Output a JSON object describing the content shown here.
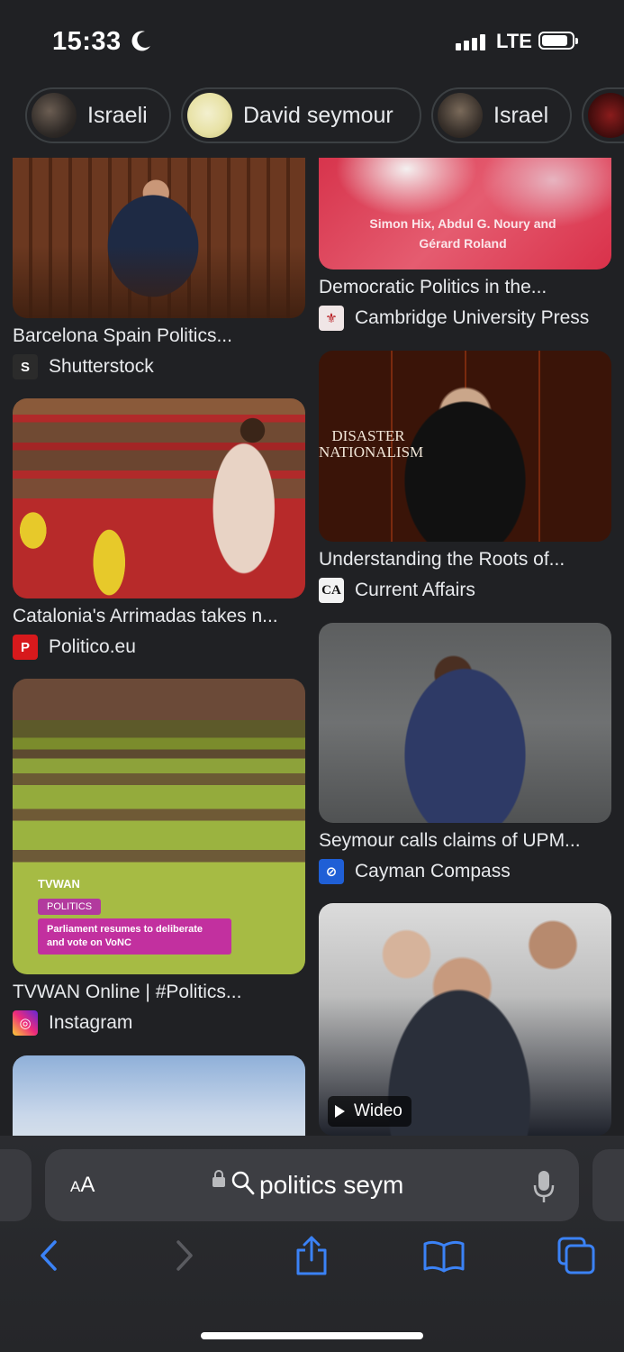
{
  "status": {
    "time": "15:33",
    "network": "LTE"
  },
  "chips": [
    {
      "label": "Israeli"
    },
    {
      "label": "David seymour"
    },
    {
      "label": "Israel"
    }
  ],
  "results": [
    {
      "title": "Barcelona Spain Politics...",
      "source": "Shutterstock",
      "favicon": "shutterstock-icon",
      "favicon_color": "#2b2b2b"
    },
    {
      "title": "Catalonia's Arrimadas takes n...",
      "source": "Politico.eu",
      "favicon": "politico-icon",
      "favicon_color": "#d7191c"
    },
    {
      "title": "TVWAN Online | #Politics...",
      "source": "Instagram",
      "favicon": "instagram-icon",
      "favicon_color": "#c13584",
      "overlay": {
        "brand": "TVWAN",
        "tag": "POLITICS",
        "caption": "Parliament resumes to deliberate and vote on VoNC"
      }
    },
    {
      "title": "Democratic Politics in the...",
      "source": "Cambridge University Press",
      "favicon": "cambridge-icon",
      "favicon_color": "#b6161c",
      "overlay": {
        "caption": "Simon Hix, Abdul G. Noury and Gérard Roland"
      }
    },
    {
      "title": "Understanding the Roots of...",
      "source": "Current Affairs",
      "favicon": "current-affairs-icon",
      "favicon_color": "#f2f2f2",
      "overlay": {
        "caption": "DISASTER NATIONALISM"
      }
    },
    {
      "title": "Seymour calls claims of UPM...",
      "source": "Cayman Compass",
      "favicon": "cayman-compass-icon",
      "favicon_color": "#1f5fd6"
    },
    {
      "badge": "Wideo"
    }
  ],
  "address_bar": {
    "text_size_small": "A",
    "text_size_large": "A",
    "url_text": "politics seym"
  },
  "colors": {
    "background": "#202124",
    "chip_border": "#3c4043",
    "toolbar_accent": "#3b82f6"
  }
}
